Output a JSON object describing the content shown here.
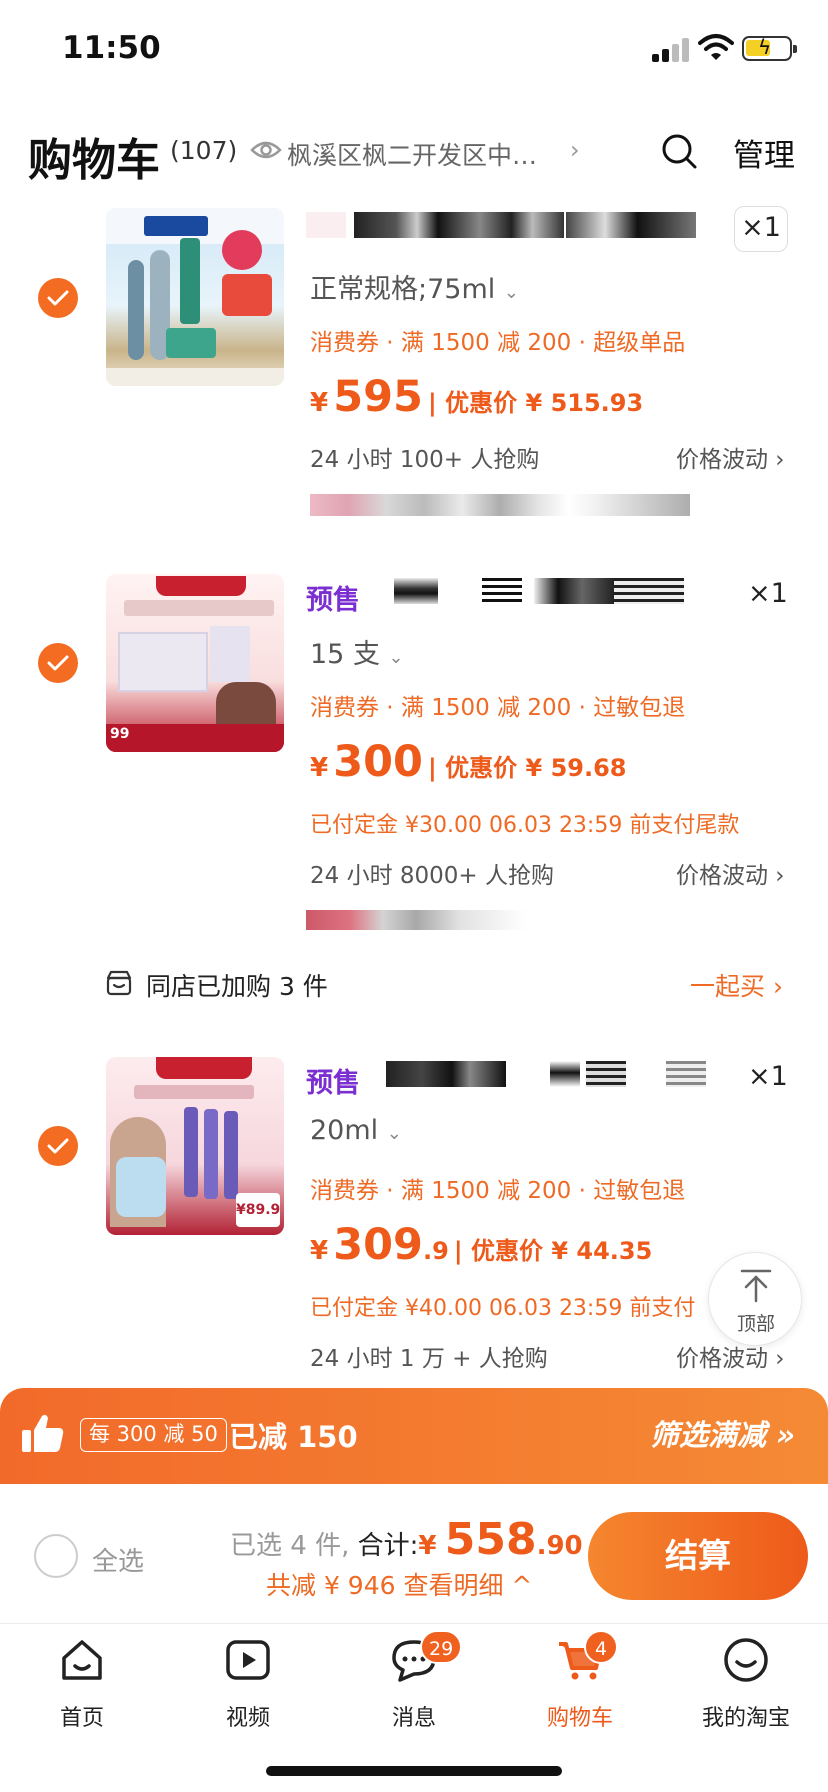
{
  "status_bar": {
    "time": "11:50"
  },
  "header": {
    "title": "购物车",
    "count": "(107)",
    "address": "枫溪区枫二开发区中…",
    "manage_label": "管理"
  },
  "items": [
    {
      "sku": "正常规格;75ml",
      "qty": "×1",
      "promo": "消费券 · 满 1500 减 200 · 超级单品",
      "price_yen": "¥",
      "price_int": "595",
      "price_dec": "",
      "discount_label": "| 优惠价 ¥ 515.93",
      "hot": "24 小时 100+ 人抢购",
      "fluct": "价格波动 ›"
    },
    {
      "presale": "预售",
      "sku": "15 支",
      "qty": "×1",
      "promo": "消费券 · 满 1500 减 200 · 过敏包退",
      "price_yen": "¥",
      "price_int": "300",
      "price_dec": "",
      "discount_label": "| 优惠价 ¥ 59.68",
      "deposit": "已付定金 ¥30.00   06.03 23:59 前支付尾款",
      "hot": "24 小时 8000+ 人抢购",
      "fluct": "价格波动 ›"
    },
    {
      "presale": "预售",
      "sku": "20ml",
      "qty": "×1",
      "promo": "消费券 · 满 1500 减 200 · 过敏包退",
      "price_yen": "¥",
      "price_int": "309",
      "price_dec": ".9",
      "discount_label": "| 优惠价 ¥ 44.35",
      "deposit": "已付定金 ¥40.00   06.03 23:59 前支付",
      "hot": "24 小时 1 万 + 人抢购",
      "fluct": "价格波动 ›"
    }
  ],
  "same_store": {
    "text": "同店已加购 3 件",
    "action": "一起买 ›"
  },
  "to_top": "顶部",
  "banner": {
    "rule": "每 300 减 50",
    "reduced": "已减 150",
    "filter": "筛选满减 »"
  },
  "checkout": {
    "select_all": "全选",
    "selected": "已选 4 件,",
    "total_label": "合计:",
    "total_yen": "¥",
    "total_int": "558",
    "total_dec": ".90",
    "saved": "共减 ¥ 946  查看明细 ^",
    "pay": "结算"
  },
  "tabs": [
    {
      "label": "首页"
    },
    {
      "label": "视频"
    },
    {
      "label": "消息",
      "badge": "29"
    },
    {
      "label": "购物车",
      "badge": "4"
    },
    {
      "label": "我的淘宝"
    }
  ],
  "colors": {
    "accent": "#ee5a1a",
    "presale": "#7b2fd0",
    "check": "#f36c21"
  }
}
